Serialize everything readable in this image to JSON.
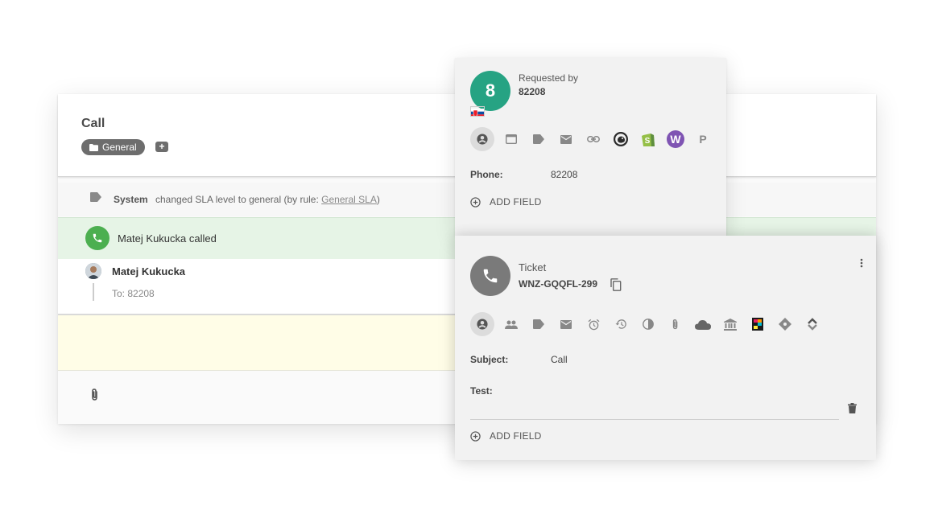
{
  "ticket": {
    "title": "Call",
    "department": "General"
  },
  "system_event": {
    "author": "System",
    "text_before": "changed SLA level to general (by rule: ",
    "link_text": "General SLA",
    "text_after": ")"
  },
  "call_event": {
    "text": "Matej Kukucka called"
  },
  "message": {
    "author": "Matej Kukucka",
    "to": "To: 82208"
  },
  "customer_card": {
    "avatar_letter": "8",
    "requested_label": "Requested by",
    "requested_value": "82208",
    "icons": [
      "person-icon",
      "browser-window-icon",
      "tag-icon",
      "mail-icon",
      "link-icon",
      "mailchimp-icon",
      "shopify-icon",
      "woocommerce-icon",
      "p-letter-icon"
    ],
    "fields": [
      {
        "label": "Phone:",
        "value": "82208"
      }
    ],
    "add_field_label": "ADD FIELD"
  },
  "ticket_card": {
    "label": "Ticket",
    "code": "WNZ-GQQFL-299",
    "icons": [
      "person-icon",
      "people-icon",
      "tag-icon",
      "mail-icon",
      "alarm-icon",
      "history-icon",
      "pie-icon",
      "paperclip-icon",
      "cloud-icon",
      "bank-icon",
      "colorful-app-icon",
      "diamond-icon",
      "chevrons-icon"
    ],
    "fields": [
      {
        "label": "Subject:",
        "value": "Call"
      },
      {
        "label": "Test:",
        "value": ""
      }
    ],
    "add_field_label": "ADD FIELD"
  },
  "colors": {
    "customer_avatar": "#26a383",
    "call_badge": "#4caf50",
    "call_row_bg": "#e6f4e6",
    "compose_bg": "#fffde7",
    "woocommerce": "#7f54b3",
    "shopify": "#95bf47"
  }
}
